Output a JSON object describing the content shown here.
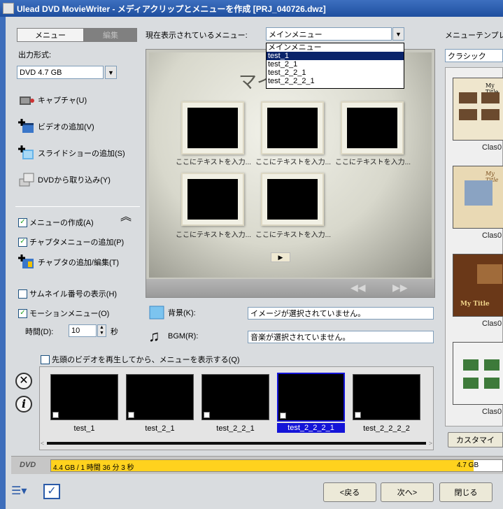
{
  "window": {
    "title": "Ulead DVD MovieWriter - メディアクリップとメニューを作成   [PRJ_040726.dwz]"
  },
  "tabs": {
    "menu": "メニュー",
    "edit": "編集"
  },
  "output": {
    "label": "出力形式:",
    "value": "DVD 4.7 GB"
  },
  "actions": {
    "capture": "キャプチャ(U)",
    "add_video": "ビデオの追加(V)",
    "add_slideshow": "スライドショーの追加(S)",
    "import_dvd": "DVDから取り込み(Y)"
  },
  "options": {
    "create_menu": "メニューの作成(A)",
    "add_chapter_menu": "チャプタメニューの追加(P)",
    "add_edit_chapter": "チャプタの追加/編集(T)",
    "show_thumb_number": "サムネイル番号の表示(H)",
    "motion_menu": "モーションメニュー(O)",
    "time_label": "時間(D):",
    "time_value": "10",
    "time_unit": "秒",
    "play_first": "先頭のビデオを再生してから、メニューを表示する(Q)"
  },
  "current_menu": {
    "label": "現在表示されているメニュー:",
    "value": "メインメニュー",
    "options": [
      "メインメニュー",
      "test_1",
      "test_2_1",
      "test_2_2_1",
      "test_2_2_2_1"
    ],
    "selected_index": 1
  },
  "preview": {
    "title": "マイタイトル",
    "thumb_captions": [
      "ここにテキストを入力...",
      "ここにテキストを入力...",
      "ここにテキストを入力...",
      "ここにテキストを入力...",
      "ここにテキストを入力..."
    ]
  },
  "background": {
    "label": "背景(K):",
    "value": "イメージが選択されていません。"
  },
  "bgm": {
    "label": "BGM(R):",
    "value": "音楽が選択されていません。"
  },
  "chapters": {
    "items": [
      "test_1",
      "test_2_1",
      "test_2_2_1",
      "test_2_2_2_1",
      "test_2_2_2_2"
    ],
    "selected_index": 3
  },
  "templates": {
    "label": "メニューテンプレ",
    "category": "クラシック",
    "items": [
      "Clas0",
      "Clas0",
      "Clas0",
      "Clas0"
    ],
    "template_title": "My Title",
    "customize": "カスタマイ"
  },
  "disk": {
    "label": "DVD",
    "usage": "4.4 GB / 1 時間 36 分 3 秒",
    "capacity": "4.7 GB",
    "fill_fraction": 0.936,
    "fill_color": "#ffd21e"
  },
  "buttons": {
    "back": "<戻る",
    "next": "次へ>",
    "close": "閉じる"
  },
  "colors": {
    "title_bar": "#2a5aa8",
    "selection": "#0a246a",
    "chapter_selected": "#1414d8"
  }
}
